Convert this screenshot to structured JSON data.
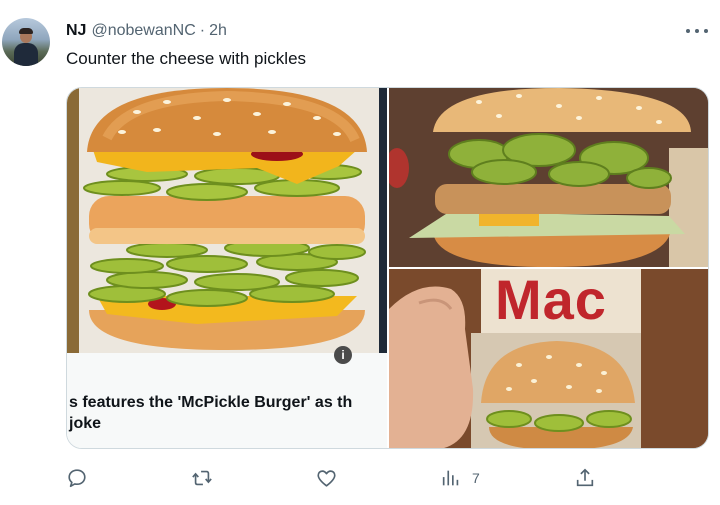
{
  "tweet": {
    "display_name": "NJ",
    "handle": "@nobewanNC",
    "separator": "·",
    "time": "2h",
    "text": "Counter the cheese with pickles"
  },
  "link_card": {
    "caption_line1": "s features the 'McPickle Burger' as th",
    "caption_line2": "joke"
  },
  "media": {
    "box_text": "Mac",
    "info_badge": "i"
  },
  "actions": {
    "reply_icon": "reply-icon",
    "retweet_icon": "retweet-icon",
    "like_icon": "heart-icon",
    "views_icon": "views-icon",
    "views_count": "7",
    "share_icon": "share-icon"
  },
  "colors": {
    "text_primary": "#0f1419",
    "text_secondary": "#536471",
    "border": "#cfd9de",
    "mac_red": "#c0262c"
  }
}
